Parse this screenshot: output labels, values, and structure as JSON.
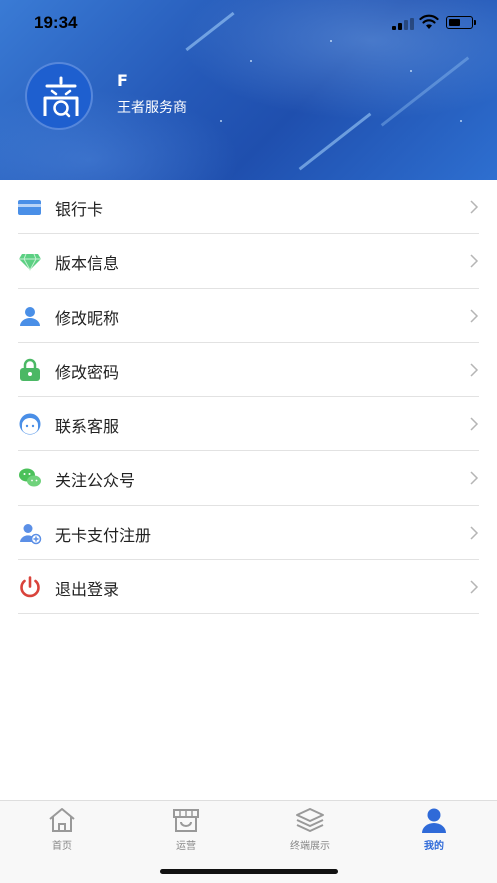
{
  "status_bar": {
    "time": "19:34",
    "battery_level": 0.55
  },
  "profile": {
    "name": "F",
    "role": "王者服务商",
    "avatar_icon": "merchant-logo-icon"
  },
  "menu": {
    "items": [
      {
        "label": "银行卡",
        "icon": "bank-card-icon",
        "color": "#4a8fe7"
      },
      {
        "label": "版本信息",
        "icon": "diamond-icon",
        "color": "#5cd083"
      },
      {
        "label": "修改昵称",
        "icon": "user-icon",
        "color": "#4a8fe7"
      },
      {
        "label": "修改密码",
        "icon": "lock-icon",
        "color": "#4bb865"
      },
      {
        "label": "联系客服",
        "icon": "customer-service-icon",
        "color": "#4a8fe7"
      },
      {
        "label": "关注公众号",
        "icon": "wechat-icon",
        "color": "#4bc15a"
      },
      {
        "label": "无卡支付注册",
        "icon": "user-add-icon",
        "color": "#5b8fe6"
      },
      {
        "label": "退出登录",
        "icon": "power-icon",
        "color": "#d9433b"
      }
    ]
  },
  "tabbar": {
    "tabs": [
      {
        "label": "首页",
        "icon": "home-icon",
        "active": false
      },
      {
        "label": "运营",
        "icon": "store-icon",
        "active": false
      },
      {
        "label": "终端展示",
        "icon": "layers-icon",
        "active": false
      },
      {
        "label": "我的",
        "icon": "profile-icon",
        "active": true
      }
    ],
    "active_color": "#2f6ad8",
    "inactive_color": "#888888"
  }
}
